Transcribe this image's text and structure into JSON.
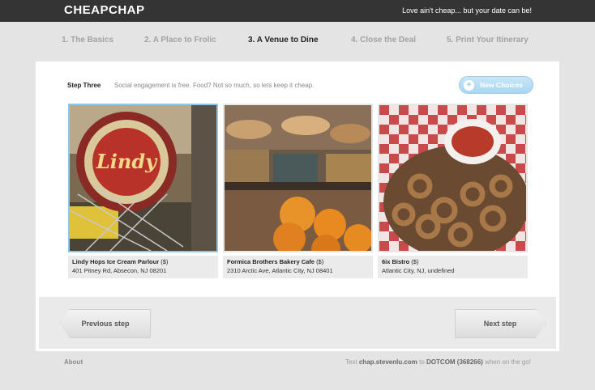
{
  "header": {
    "logo": "CHEAPCHAP",
    "tagline": "Love ain't cheap... but your date can be!"
  },
  "steps": [
    {
      "label": "1. The Basics",
      "active": false
    },
    {
      "label": "2. A Place to Frolic",
      "active": false
    },
    {
      "label": "3. A Venue to Dine",
      "active": true
    },
    {
      "label": "4. Close the Deal",
      "active": false
    },
    {
      "label": "5. Print Your Itinerary",
      "active": false
    }
  ],
  "panel": {
    "step_title": "Step Three",
    "step_description": "Social engagement is free. Food? Not so much, so lets keep it cheap.",
    "new_choices_label": "New Choices",
    "new_choices_icon": "plus-circle-icon"
  },
  "venues": [
    {
      "name": "Lindy Hops Ice Cream Parlour",
      "price": "($)",
      "address": "401 Pitney Rd, Absecon, NJ 08201",
      "selected": true
    },
    {
      "name": "Formica Brothers Bakery Cafe",
      "price": "($)",
      "address": "2310 Arctic Ave, Atlantic City, NJ 08401",
      "selected": false
    },
    {
      "name": "6ix Bistro",
      "price": "($)",
      "address": "Atlantic City, NJ, undefined",
      "selected": false
    }
  ],
  "nav": {
    "previous_label": "Previous step",
    "next_label": "Next step"
  },
  "footer": {
    "about": "About",
    "text_prefix": "Text",
    "text_domain": "chap.stevenlu.com",
    "text_middle": "to",
    "text_code": "DOTCOM (368266)",
    "text_suffix": "when on the go!"
  },
  "colors": {
    "topbar": "#343434",
    "background": "#e4e4e4",
    "accent": "#a8d6f2",
    "selected_border": "#8cc8ea"
  }
}
